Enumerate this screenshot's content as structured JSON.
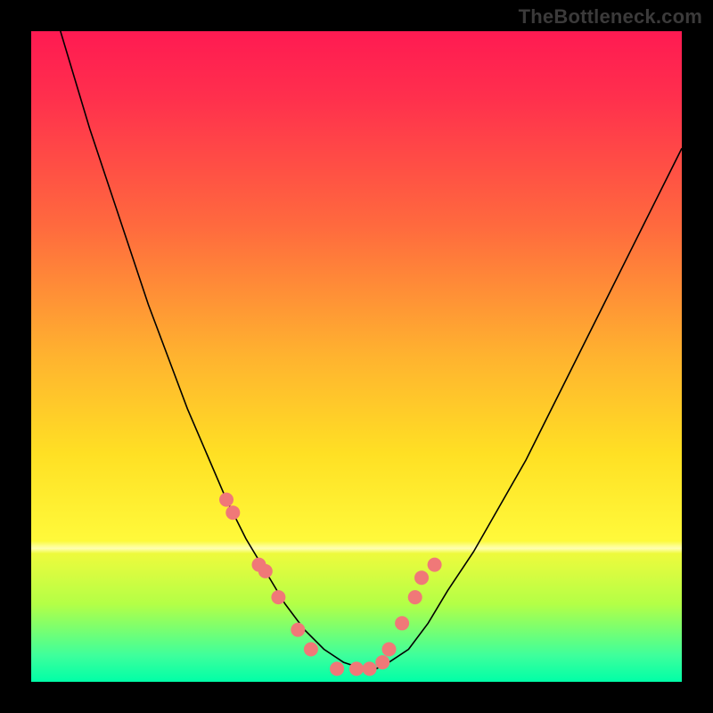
{
  "watermark": "TheBottleneck.com",
  "colors": {
    "frame": "#000000",
    "curve_stroke": "#000000",
    "dot_fill": "#f07878",
    "dot_stroke": "#c44f4f"
  },
  "chart_data": {
    "type": "line",
    "title": "",
    "xlabel": "",
    "ylabel": "",
    "xlim": [
      0,
      100
    ],
    "ylim": [
      0,
      100
    ],
    "x": [
      0,
      3,
      6,
      9,
      12,
      15,
      18,
      21,
      24,
      27,
      30,
      33,
      36,
      39,
      42,
      45,
      48,
      51,
      53,
      55,
      58,
      61,
      64,
      68,
      72,
      76,
      80,
      84,
      88,
      92,
      96,
      100
    ],
    "values": [
      115,
      105,
      95,
      85,
      76,
      67,
      58,
      50,
      42,
      35,
      28,
      22,
      17,
      12,
      8,
      5,
      3,
      2,
      2,
      3,
      5,
      9,
      14,
      20,
      27,
      34,
      42,
      50,
      58,
      66,
      74,
      82
    ],
    "markers_x": [
      30,
      31,
      35,
      36,
      38,
      41,
      43,
      47,
      50,
      52,
      54,
      55,
      57,
      59,
      60,
      62
    ],
    "markers_y": [
      28,
      26,
      18,
      17,
      13,
      8,
      5,
      2,
      2,
      2,
      3,
      5,
      9,
      13,
      16,
      18
    ]
  }
}
